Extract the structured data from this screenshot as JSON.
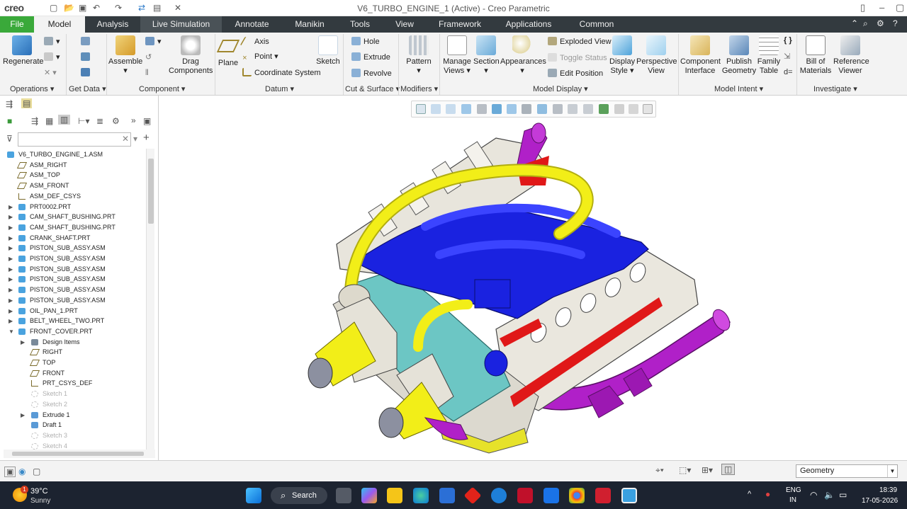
{
  "app": {
    "logo": "creo",
    "window_title": "V6_TURBO_ENGINE_1 (Active) - Creo Parametric"
  },
  "menu_tabs": [
    "File",
    "Model",
    "Analysis",
    "Live Simulation",
    "Annotate",
    "Manikin",
    "Tools",
    "View",
    "Framework",
    "Applications",
    "Common"
  ],
  "ribbon": {
    "operations": {
      "regenerate": "Regenerate",
      "group": "Operations"
    },
    "get_data": {
      "group": "Get Data"
    },
    "component": {
      "assemble": "Assemble",
      "drag": "Drag Components",
      "group": "Component"
    },
    "datum": {
      "plane": "Plane",
      "axis": "Axis",
      "point": "Point",
      "csys": "Coordinate System",
      "sketch": "Sketch",
      "group": "Datum"
    },
    "cut_surface": {
      "hole": "Hole",
      "extrude": "Extrude",
      "revolve": "Revolve",
      "group": "Cut & Surface"
    },
    "modifiers": {
      "pattern": "Pattern",
      "group": "Modifiers"
    },
    "model_display": {
      "manage_views": "Manage Views",
      "section": "Section",
      "appearances": "Appearances",
      "exploded": "Exploded View",
      "toggle_status": "Toggle Status",
      "edit_position": "Edit Position",
      "display_style": "Display Style",
      "perspective": "Perspective View",
      "group": "Model Display"
    },
    "model_intent": {
      "component_interface": "Component Interface",
      "publish_geometry": "Publish Geometry",
      "family_table": "Family Table",
      "group": "Model Intent"
    },
    "investigate": {
      "bom": "Bill of Materials",
      "reference_viewer": "Reference Viewer",
      "group": "Investigate"
    }
  },
  "tree": [
    {
      "label": "V6_TURBO_ENGINE_1.ASM",
      "type": "asm",
      "level": 0,
      "expander": "",
      "disabled": false
    },
    {
      "label": "ASM_RIGHT",
      "type": "plane",
      "level": 1,
      "expander": "",
      "disabled": false
    },
    {
      "label": "ASM_TOP",
      "type": "plane",
      "level": 1,
      "expander": "",
      "disabled": false
    },
    {
      "label": "ASM_FRONT",
      "type": "plane",
      "level": 1,
      "expander": "",
      "disabled": false
    },
    {
      "label": "ASM_DEF_CSYS",
      "type": "csys",
      "level": 1,
      "expander": "",
      "disabled": false
    },
    {
      "label": "PRT0002.PRT",
      "type": "part",
      "level": 1,
      "expander": "▶",
      "disabled": false
    },
    {
      "label": "CAM_SHAFT_BUSHING.PRT",
      "type": "part",
      "level": 1,
      "expander": "▶",
      "disabled": false
    },
    {
      "label": "CAM_SHAFT_BUSHING.PRT",
      "type": "part",
      "level": 1,
      "expander": "▶",
      "disabled": false
    },
    {
      "label": "CRANK_SHAFT.PRT",
      "type": "part",
      "level": 1,
      "expander": "▶",
      "disabled": false
    },
    {
      "label": "PISTON_SUB_ASSY.ASM",
      "type": "asm",
      "level": 1,
      "expander": "▶",
      "disabled": false
    },
    {
      "label": "PISTON_SUB_ASSY.ASM",
      "type": "asm",
      "level": 1,
      "expander": "▶",
      "disabled": false
    },
    {
      "label": "PISTON_SUB_ASSY.ASM",
      "type": "asm",
      "level": 1,
      "expander": "▶",
      "disabled": false
    },
    {
      "label": "PISTON_SUB_ASSY.ASM",
      "type": "asm",
      "level": 1,
      "expander": "▶",
      "disabled": false
    },
    {
      "label": "PISTON_SUB_ASSY.ASM",
      "type": "asm",
      "level": 1,
      "expander": "▶",
      "disabled": false
    },
    {
      "label": "PISTON_SUB_ASSY.ASM",
      "type": "asm",
      "level": 1,
      "expander": "▶",
      "disabled": false
    },
    {
      "label": "OIL_PAN_1.PRT",
      "type": "part",
      "level": 1,
      "expander": "▶",
      "disabled": false
    },
    {
      "label": "BELT_WHEEL_TWO.PRT",
      "type": "part",
      "level": 1,
      "expander": "▶",
      "disabled": false
    },
    {
      "label": "FRONT_COVER.PRT",
      "type": "part",
      "level": 1,
      "expander": "▼",
      "disabled": false
    },
    {
      "label": "Design Items",
      "type": "items",
      "level": 2,
      "expander": "▶",
      "disabled": false
    },
    {
      "label": "RIGHT",
      "type": "plane",
      "level": 2,
      "expander": "",
      "disabled": false
    },
    {
      "label": "TOP",
      "type": "plane",
      "level": 2,
      "expander": "",
      "disabled": false
    },
    {
      "label": "FRONT",
      "type": "plane",
      "level": 2,
      "expander": "",
      "disabled": false
    },
    {
      "label": "PRT_CSYS_DEF",
      "type": "csys",
      "level": 2,
      "expander": "",
      "disabled": false
    },
    {
      "label": "Sketch 1",
      "type": "sketch",
      "level": 2,
      "expander": "",
      "disabled": true
    },
    {
      "label": "Sketch 2",
      "type": "sketch",
      "level": 2,
      "expander": "",
      "disabled": true
    },
    {
      "label": "Extrude 1",
      "type": "extrude",
      "level": 2,
      "expander": "▶",
      "disabled": false
    },
    {
      "label": "Draft 1",
      "type": "draft",
      "level": 2,
      "expander": "",
      "disabled": false
    },
    {
      "label": "Sketch 3",
      "type": "sketch",
      "level": 2,
      "expander": "",
      "disabled": true
    },
    {
      "label": "Sketch 4",
      "type": "sketch",
      "level": 2,
      "expander": "",
      "disabled": true
    }
  ],
  "status": {
    "selection_filter": "Geometry"
  },
  "taskbar": {
    "weather_temp": "39°C",
    "weather_desc": "Sunny",
    "weather_badge": "1",
    "search_label": "Search",
    "lang_top": "ENG",
    "lang_bottom": "IN",
    "time": "18:39",
    "date": "17-05-2026"
  },
  "colors": {
    "menubar": "#333a3f",
    "file_tab": "#3aa93a",
    "engine_blue": "#1a22e0",
    "engine_yellow": "#f2ee18",
    "engine_purple": "#b020c8",
    "engine_teal": "#6cc6c4",
    "engine_red": "#e01818"
  }
}
